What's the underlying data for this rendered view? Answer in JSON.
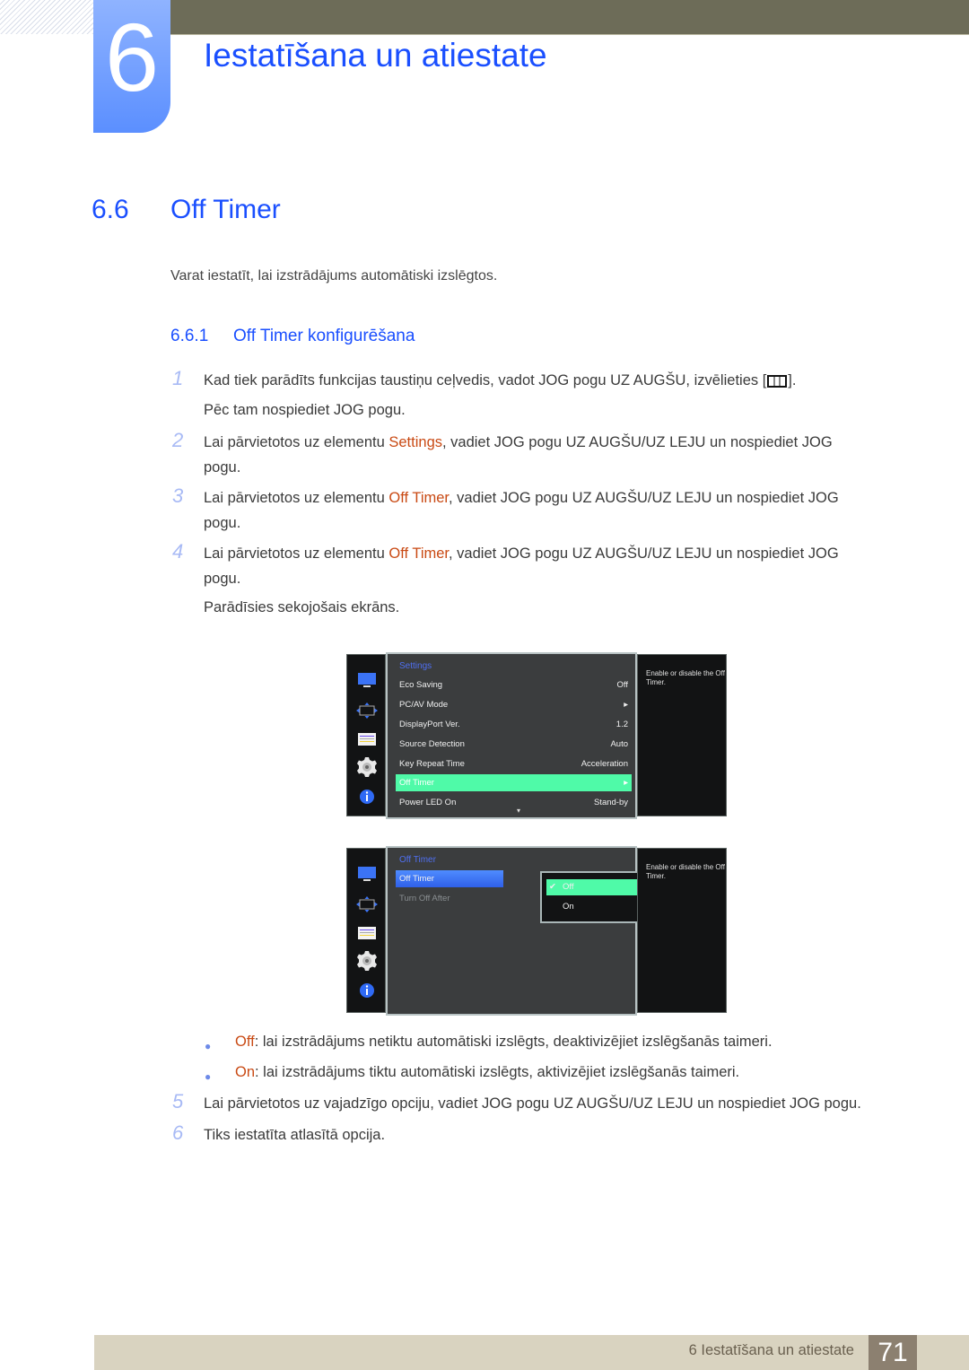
{
  "header": {
    "chapter_number": "6",
    "chapter_title": "Iestatīšana un atiestate"
  },
  "section": {
    "number": "6.6",
    "title": "Off Timer",
    "intro": "Varat iestatīt, lai izstrādājums automātiski izslēgtos."
  },
  "subsection": {
    "number": "6.6.1",
    "title": "Off Timer konfigurēšana"
  },
  "steps": [
    {
      "num": "1",
      "line1_a": "Kad tiek parādīts funkcijas taustiņu ceļvedis, vadot JOG pogu UZ AUGŠU, izvēlieties [",
      "icon": "menu-icon",
      "line1_b": "].",
      "line2": "Pēc tam nospiediet JOG pogu."
    },
    {
      "num": "2",
      "pre": "Lai pārvietotos uz elementu ",
      "highlight": "Settings",
      "post": ", vadiet JOG pogu UZ AUGŠU/UZ LEJU un nospiediet JOG",
      "line2": "pogu."
    },
    {
      "num": "3",
      "pre": "Lai pārvietotos uz elementu ",
      "highlight": "Off Timer",
      "post": ", vadiet JOG pogu UZ AUGŠU/UZ LEJU un nospiediet JOG",
      "line2": "pogu."
    },
    {
      "num": "4",
      "pre": "Lai pārvietotos uz elementu ",
      "highlight": "Off Timer",
      "post": ", vadiet JOG pogu UZ AUGŠU/UZ LEJU un nospiediet JOG",
      "line2": "pogu.",
      "line3": "Parādīsies sekojošais ekrāns."
    },
    {
      "num": "5",
      "text": "Lai pārvietotos uz vajadzīgo opciju, vadiet JOG pogu UZ AUGŠU/UZ LEJU un nospiediet JOG pogu."
    },
    {
      "num": "6",
      "text": "Tiks iestatīta atlasītā opcija."
    }
  ],
  "bullets": [
    {
      "term": "Off",
      "text": ": lai izstrādājums netiktu automātiski izslēgts, deaktivizējiet izslēgšanās taimeri."
    },
    {
      "term": "On",
      "text": ": lai izstrādājums tiktu automātiski izslēgts, aktivizējiet izslēgšanās taimeri."
    }
  ],
  "osd1": {
    "title": "Settings",
    "items": [
      {
        "label": "Eco Saving",
        "value": "Off"
      },
      {
        "label": "PC/AV Mode",
        "value": "▸"
      },
      {
        "label": "DisplayPort Ver.",
        "value": "1.2"
      },
      {
        "label": "Source Detection",
        "value": "Auto"
      },
      {
        "label": "Key Repeat Time",
        "value": "Acceleration"
      },
      {
        "label": "Off Timer",
        "value": "▸",
        "selected": true
      },
      {
        "label": "Power LED On",
        "value": "Stand-by"
      }
    ],
    "more_indicator": "▾",
    "help": "Enable or disable the Off Timer."
  },
  "osd2": {
    "title": "Off Timer",
    "items": [
      {
        "label": "Off Timer",
        "selected": true
      },
      {
        "label": "Turn Off After",
        "disabled": true
      }
    ],
    "options": [
      {
        "label": "Off",
        "checked": true
      },
      {
        "label": "On"
      }
    ],
    "check_glyph": "✔",
    "help": "Enable or disable the Off Timer."
  },
  "osd_side_icons": [
    "picture-icon",
    "screen-size-icon",
    "osd-adjust-icon",
    "settings-gear-icon",
    "info-icon"
  ],
  "colors": {
    "brand_blue": "#1a4fff",
    "highlight_orange": "#c94a14",
    "osd_selected": "#4ffaa8",
    "osd_focus_blue": "#3b6cf0"
  },
  "footer": {
    "label": "6 Iestatīšana un atiestate",
    "page_number": "71"
  }
}
